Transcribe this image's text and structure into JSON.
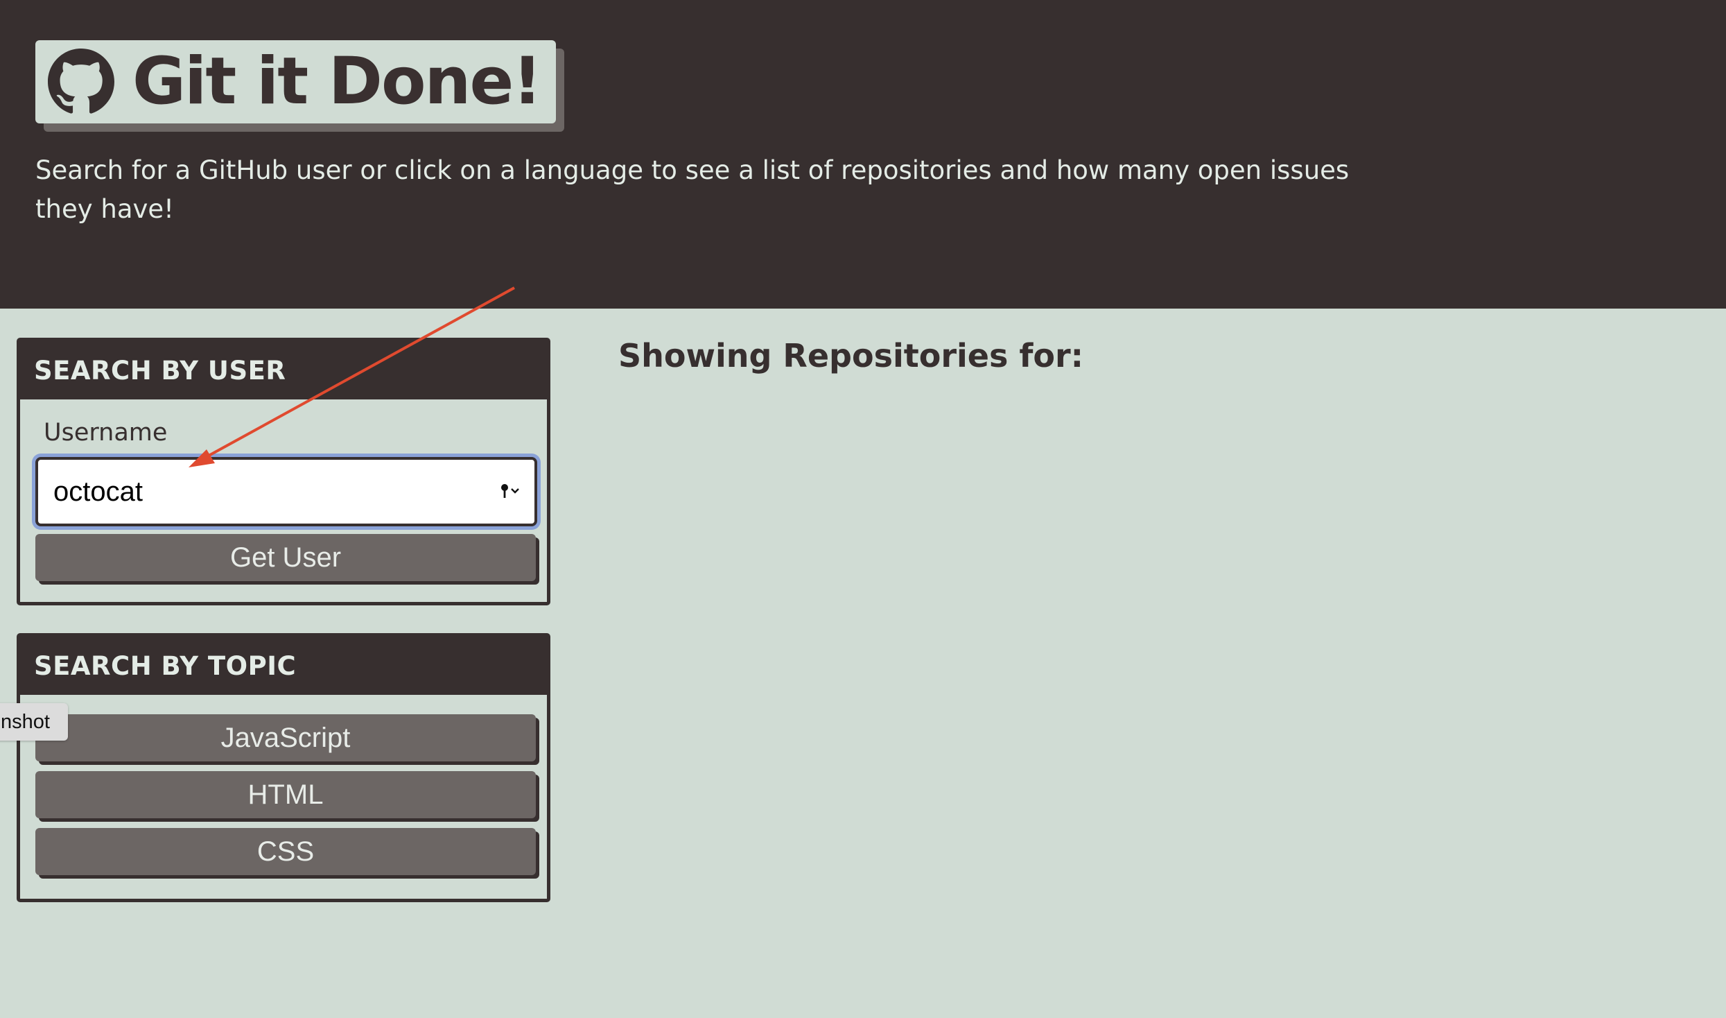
{
  "header": {
    "title": "Git it Done!",
    "subtitle": "Search for a GitHub user or click on a language to see a list of repositories and how many open issues they have!",
    "logo_icon": "github-octocat-icon"
  },
  "user_search": {
    "heading": "SEARCH BY USER",
    "label": "Username",
    "value": "octocat",
    "submit_label": "Get User",
    "autofill_icon": "key-icon"
  },
  "topic_search": {
    "heading": "SEARCH BY TOPIC",
    "topics": [
      "JavaScript",
      "HTML",
      "CSS"
    ]
  },
  "results": {
    "title": "Showing Repositories for:"
  },
  "overlay": {
    "tooltip_text": "nshot",
    "arrow_color": "#e04a2f"
  },
  "colors": {
    "dark": "#372f2f",
    "light": "#d0dcd4",
    "button": "#6c6664",
    "focus_ring": "#8aa2d8"
  }
}
